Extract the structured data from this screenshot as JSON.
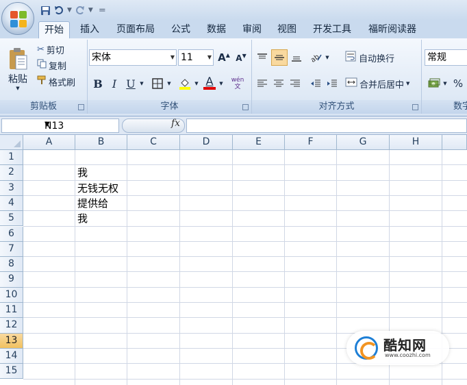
{
  "quick_access": {
    "undo_icon": "undo-icon",
    "redo_icon": "redo-icon",
    "customize": "="
  },
  "tabs": [
    "开始",
    "插入",
    "页面布局",
    "公式",
    "数据",
    "审阅",
    "视图",
    "开发工具",
    "福昕阅读器"
  ],
  "active_tab": "开始",
  "ribbon": {
    "clipboard": {
      "paste": "粘贴",
      "cut": "剪切",
      "copy": "复制",
      "format_painter": "格式刷",
      "label": "剪贴板"
    },
    "font": {
      "font_name": "宋体",
      "font_size": "11",
      "bold": "B",
      "italic": "I",
      "underline": "U",
      "font_color_letter": "A",
      "phonetic": "wén 文",
      "label": "字体"
    },
    "alignment": {
      "wrap_text": "自动换行",
      "merge_center": "合并后居中",
      "label": "对齐方式"
    },
    "number": {
      "format": "常规",
      "percent": "%",
      "label": "数字"
    }
  },
  "formula_bar": {
    "name_box": "N13",
    "fx": "fx",
    "value": ""
  },
  "columns": [
    "A",
    "B",
    "C",
    "D",
    "E",
    "F",
    "G",
    "H"
  ],
  "rows": [
    "1",
    "2",
    "3",
    "4",
    "5",
    "6",
    "7",
    "8",
    "9",
    "10",
    "11",
    "12",
    "13",
    "14",
    "15"
  ],
  "selected_row": "13",
  "cells": {
    "B2": "我",
    "B3": "无钱无权",
    "B4": "提供给",
    "B5": "我"
  },
  "watermark": {
    "title": "酷知网",
    "url": "www.coozhi.com"
  },
  "colors": {
    "accent": "#2b579a",
    "selected_row": "#f1c15f",
    "grid_line": "#d0d7e5"
  }
}
